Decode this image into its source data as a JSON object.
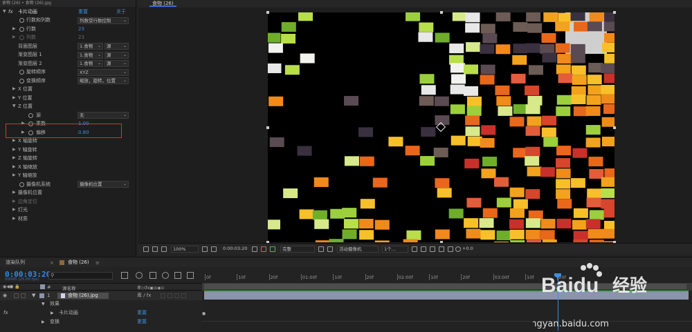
{
  "breadcrumb": "食物 (26) • 食物 (26).jpg",
  "effect": {
    "name": "卡片动画",
    "reset": "重置",
    "about": "关于"
  },
  "props": {
    "rowcol": {
      "label": "行数和列数",
      "value": "列数受行数控制"
    },
    "rows": {
      "label": "行数",
      "value": "23"
    },
    "cols": {
      "label": "列数",
      "value": "23"
    },
    "back": {
      "label": "背面图层",
      "value": "1.食物",
      "src": "源"
    },
    "grad1": {
      "label": "渐变图层 1",
      "value": "1.食物",
      "src": "源"
    },
    "grad2": {
      "label": "渐变图层 2",
      "value": "1.食物",
      "src": "源"
    },
    "rotorder": {
      "label": "旋转顺序",
      "value": "XYZ"
    },
    "xformorder": {
      "label": "变换顺序",
      "value": "缩放，旋转，位置"
    },
    "xpos": {
      "label": "X 位置"
    },
    "ypos": {
      "label": "Y 位置"
    },
    "zpos": {
      "label": "Z 位置"
    },
    "source": {
      "label": "源",
      "value": "无"
    },
    "mult": {
      "label": "乘数",
      "value": "1.00"
    },
    "offset": {
      "label": "偏移",
      "value": "0.80"
    },
    "xrot": {
      "label": "X 轴旋转"
    },
    "yrot": {
      "label": "Y 轴旋转"
    },
    "zrot": {
      "label": "Z 轴旋转"
    },
    "xscale": {
      "label": "X 轴缩放"
    },
    "yscale": {
      "label": "Y 轴缩放"
    },
    "camsys": {
      "label": "摄像机系统",
      "value": "摄像机位置"
    },
    "campos": {
      "label": "摄像机位置"
    },
    "cornerpins": {
      "label": "边角定位"
    },
    "light": {
      "label": "灯光"
    },
    "material": {
      "label": "材质"
    }
  },
  "comp": {
    "tab": "食物 (26)"
  },
  "viewer_bar": {
    "zoom": "100%",
    "time": "0:00:03:20",
    "resolution": "完整",
    "camera": "活动摄像机",
    "views": "1个...",
    "exposure": "+0.0"
  },
  "timeline": {
    "tabs": [
      "渲染队列",
      "食物 (26)"
    ],
    "timecode": "0:00:03:20",
    "fps": "00095 (25.00 fps)",
    "search_placeholder": "",
    "col_hash": "#",
    "col_name": "源名称",
    "layer": {
      "num": "1",
      "name": "食物 (26).jpg"
    },
    "effects_group": "效果",
    "effect_item": "卡片动画",
    "effect_reset": "重置",
    "transform": "变换",
    "transform_reset": "重置",
    "fx": "fx",
    "ruler": [
      "0f",
      "10f",
      "20f",
      "01:00f",
      "10f",
      "20f",
      "02:00f",
      "10f",
      "20f",
      "03:00f",
      "10f",
      "20f"
    ]
  },
  "watermark": {
    "brand": "Baidu",
    "jy": "经验",
    "url": "jingyan.baidu.com"
  },
  "colors": {
    "accent": "#3d8ee0",
    "highlight": "#c9393a",
    "track": "#8c94ad",
    "green": "#2fb43f",
    "orange": "#f08a1a"
  }
}
